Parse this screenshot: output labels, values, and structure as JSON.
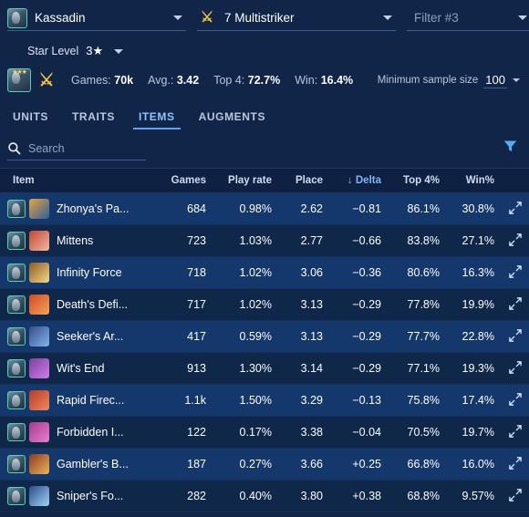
{
  "filters": {
    "unit": {
      "label": "Kassadin",
      "icon": "unit-portrait-icon"
    },
    "trait": {
      "label": "7 Multistriker",
      "icon": "multistriker-trait-icon"
    },
    "third": {
      "placeholder": "Filter #3"
    },
    "star_level": {
      "label": "Star Level",
      "value": "3★"
    }
  },
  "stats": {
    "games_label": "Games:",
    "games_value": "70k",
    "avg_label": "Avg.:",
    "avg_value": "3.42",
    "top4_label": "Top 4:",
    "top4_value": "72.7%",
    "win_label": "Win:",
    "win_value": "16.4%",
    "min_sample_label": "Minimum sample size",
    "min_sample_value": "100"
  },
  "tabs": [
    {
      "label": "UNITS",
      "active": false
    },
    {
      "label": "TRAITS",
      "active": false
    },
    {
      "label": "ITEMS",
      "active": true
    },
    {
      "label": "AUGMENTS",
      "active": false
    }
  ],
  "search": {
    "value": "",
    "placeholder": "Search"
  },
  "table": {
    "headers": {
      "item": "Item",
      "games": "Games",
      "play_rate": "Play rate",
      "place": "Place",
      "delta": "↓ Delta",
      "top4": "Top 4%",
      "win": "Win%"
    },
    "rows": [
      {
        "name": "Zhonya's Pa...",
        "games": "684",
        "play_rate": "0.98%",
        "place": "2.62",
        "delta": "−0.81",
        "top4": "86.1%",
        "win": "30.8%",
        "icon_colors": [
          "#e8a33d",
          "#2e5f9e"
        ]
      },
      {
        "name": "Mittens",
        "games": "723",
        "play_rate": "1.03%",
        "place": "2.77",
        "delta": "−0.66",
        "top4": "83.8%",
        "win": "27.1%",
        "icon_colors": [
          "#c2452e",
          "#f0b9a4"
        ]
      },
      {
        "name": "Infinity Force",
        "games": "718",
        "play_rate": "1.02%",
        "place": "3.06",
        "delta": "−0.36",
        "top4": "80.6%",
        "win": "16.3%",
        "icon_colors": [
          "#8a5a1d",
          "#f5d98a"
        ]
      },
      {
        "name": "Death's Defi...",
        "games": "717",
        "play_rate": "1.02%",
        "place": "3.13",
        "delta": "−0.29",
        "top4": "77.8%",
        "win": "19.9%",
        "icon_colors": [
          "#d4471f",
          "#f2a65a"
        ]
      },
      {
        "name": "Seeker's Ar...",
        "games": "417",
        "play_rate": "0.59%",
        "place": "3.13",
        "delta": "−0.29",
        "top4": "77.7%",
        "win": "22.8%",
        "icon_colors": [
          "#3a4a8c",
          "#7fb6e8"
        ]
      },
      {
        "name": "Wit's End",
        "games": "913",
        "play_rate": "1.30%",
        "place": "3.14",
        "delta": "−0.29",
        "top4": "77.1%",
        "win": "19.3%",
        "icon_colors": [
          "#7b3fa0",
          "#d07fe8"
        ]
      },
      {
        "name": "Rapid Firec...",
        "games": "1.1k",
        "play_rate": "1.50%",
        "place": "3.29",
        "delta": "−0.13",
        "top4": "75.8%",
        "win": "17.4%",
        "icon_colors": [
          "#b83a2a",
          "#f08a5a"
        ]
      },
      {
        "name": "Forbidden I...",
        "games": "122",
        "play_rate": "0.17%",
        "place": "3.38",
        "delta": "−0.04",
        "top4": "70.5%",
        "win": "19.7%",
        "icon_colors": [
          "#a83a8c",
          "#e87fd0"
        ]
      },
      {
        "name": "Gambler's B...",
        "games": "187",
        "play_rate": "0.27%",
        "place": "3.66",
        "delta": "+0.25",
        "top4": "66.8%",
        "win": "16.0%",
        "icon_colors": [
          "#8c3a1f",
          "#e8b45a"
        ]
      },
      {
        "name": "Sniper's Fo...",
        "games": "282",
        "play_rate": "0.40%",
        "place": "3.80",
        "delta": "+0.38",
        "top4": "68.8%",
        "win": "9.57%",
        "icon_colors": [
          "#2a4a8c",
          "#9fd4f5"
        ]
      }
    ]
  },
  "colors": {
    "background": "#112548",
    "accent": "#5aa3f0",
    "row_odd": "#15386c",
    "row_even": "#0f2749",
    "unit_border": "#4ad6b8",
    "trait_gold": "#f3c13a"
  }
}
